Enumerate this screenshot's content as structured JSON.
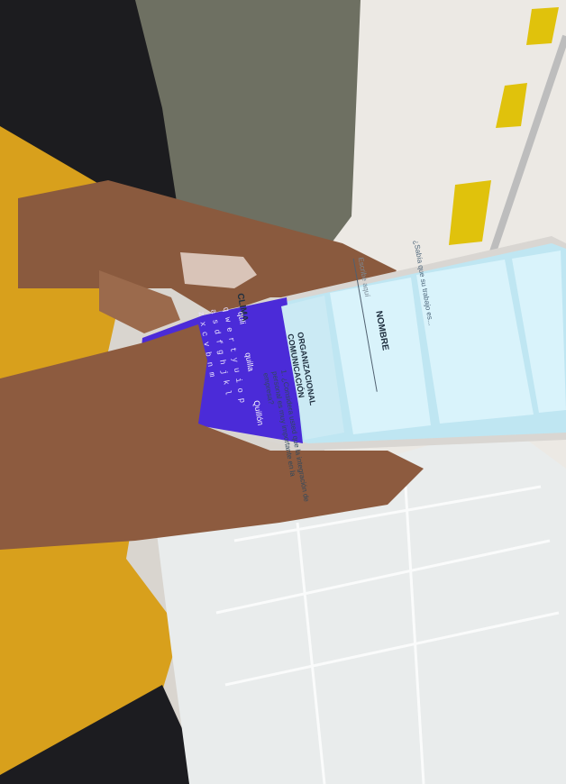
{
  "screen": {
    "top_note": "¿Sabía que su trabajo es...",
    "nombre_label": "NOMBRE",
    "nombre_placeholder": "Escribe aquí",
    "category1": "ORGANIZACIONAL",
    "category2": "COMUNICACIÓN",
    "clima_label": "CLIMA",
    "question": "1. ¿Considera usted que la integración de personal es muy importante en la empresa?"
  },
  "keyboard": {
    "suggestions": [
      "quli",
      "quilla",
      "Quillón"
    ],
    "row1": "qwertyuiop",
    "row2": "asdfghjkl",
    "row3": "zxcvbnm"
  },
  "colors": {
    "keyboard": "#4b2bd8",
    "screen_bg": "#bfe6f2",
    "card": "#d9f3fb",
    "sweater": "#d9a21c",
    "bubble_wrap": "#ecefef"
  }
}
